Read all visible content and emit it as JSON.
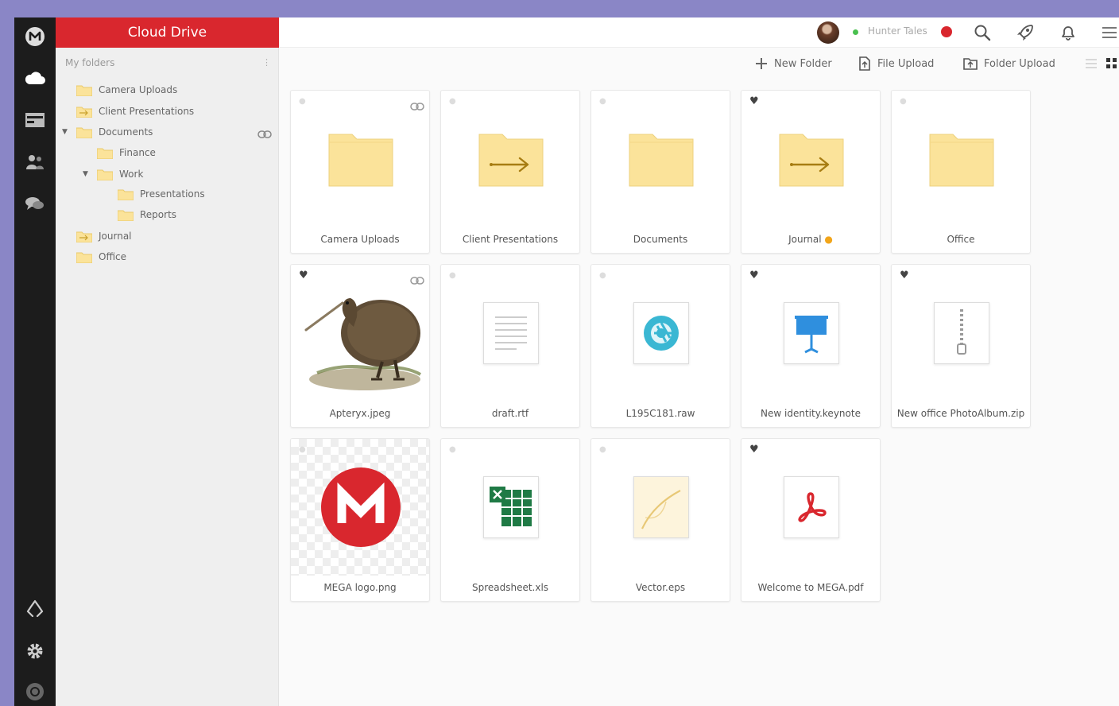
{
  "app": {
    "title": "Cloud Drive",
    "accent": "#d9272e"
  },
  "rail": {
    "icons": [
      "mega-logo-icon",
      "cloud-icon",
      "inbox-icon",
      "contacts-icon",
      "chat-icon",
      "rubbish-bin-icon",
      "settings-icon",
      "help-icon"
    ]
  },
  "tree": {
    "header": "My folders",
    "items": [
      {
        "label": "Camera Uploads",
        "level": 0,
        "expanded": false
      },
      {
        "label": "Client Presentations",
        "level": 0,
        "expanded": false
      },
      {
        "label": "Documents",
        "level": 0,
        "expanded": true
      },
      {
        "label": "Finance",
        "level": 1,
        "expanded": false
      },
      {
        "label": "Work",
        "level": 1,
        "expanded": true
      },
      {
        "label": "Presentations",
        "level": 2,
        "expanded": false
      },
      {
        "label": "Reports",
        "level": 2,
        "expanded": false
      },
      {
        "label": "Journal",
        "level": 0,
        "expanded": false
      },
      {
        "label": "Office",
        "level": 0,
        "expanded": false
      }
    ]
  },
  "topbar": {
    "user_name": "Hunter Tales"
  },
  "actions": {
    "new_folder": "New Folder",
    "file_upload": "File Upload",
    "folder_upload": "Folder Upload"
  },
  "files": [
    {
      "name": "Camera Uploads",
      "kind": "folder",
      "favorite": false,
      "linked": true,
      "starred": false
    },
    {
      "name": "Client Presentations",
      "kind": "folder-shared",
      "favorite": false,
      "linked": false,
      "starred": false
    },
    {
      "name": "Documents",
      "kind": "folder",
      "favorite": false,
      "linked": false,
      "starred": false
    },
    {
      "name": "Journal",
      "kind": "folder-shared",
      "favorite": true,
      "linked": false,
      "starred": true
    },
    {
      "name": "Office",
      "kind": "folder",
      "favorite": false,
      "linked": false,
      "starred": false
    },
    {
      "name": "Apteryx.jpeg",
      "kind": "image-kiwi",
      "favorite": true,
      "linked": true,
      "starred": false
    },
    {
      "name": "draft.rtf",
      "kind": "text",
      "favorite": false,
      "linked": false,
      "starred": false
    },
    {
      "name": "L195C181.raw",
      "kind": "raw",
      "favorite": false,
      "linked": false,
      "starred": false
    },
    {
      "name": "New identity.keynote",
      "kind": "keynote",
      "favorite": true,
      "linked": false,
      "starred": false
    },
    {
      "name": "New office PhotoAlbum.zip",
      "kind": "zip",
      "favorite": true,
      "linked": false,
      "starred": false
    },
    {
      "name": "MEGA logo.png",
      "kind": "image-mega",
      "favorite": false,
      "linked": false,
      "starred": false
    },
    {
      "name": "Spreadsheet.xls",
      "kind": "excel",
      "favorite": false,
      "linked": false,
      "starred": false
    },
    {
      "name": "Vector.eps",
      "kind": "vector",
      "favorite": false,
      "linked": false,
      "starred": false
    },
    {
      "name": "Welcome to MEGA.pdf",
      "kind": "pdf",
      "favorite": true,
      "linked": false,
      "starred": false
    }
  ]
}
